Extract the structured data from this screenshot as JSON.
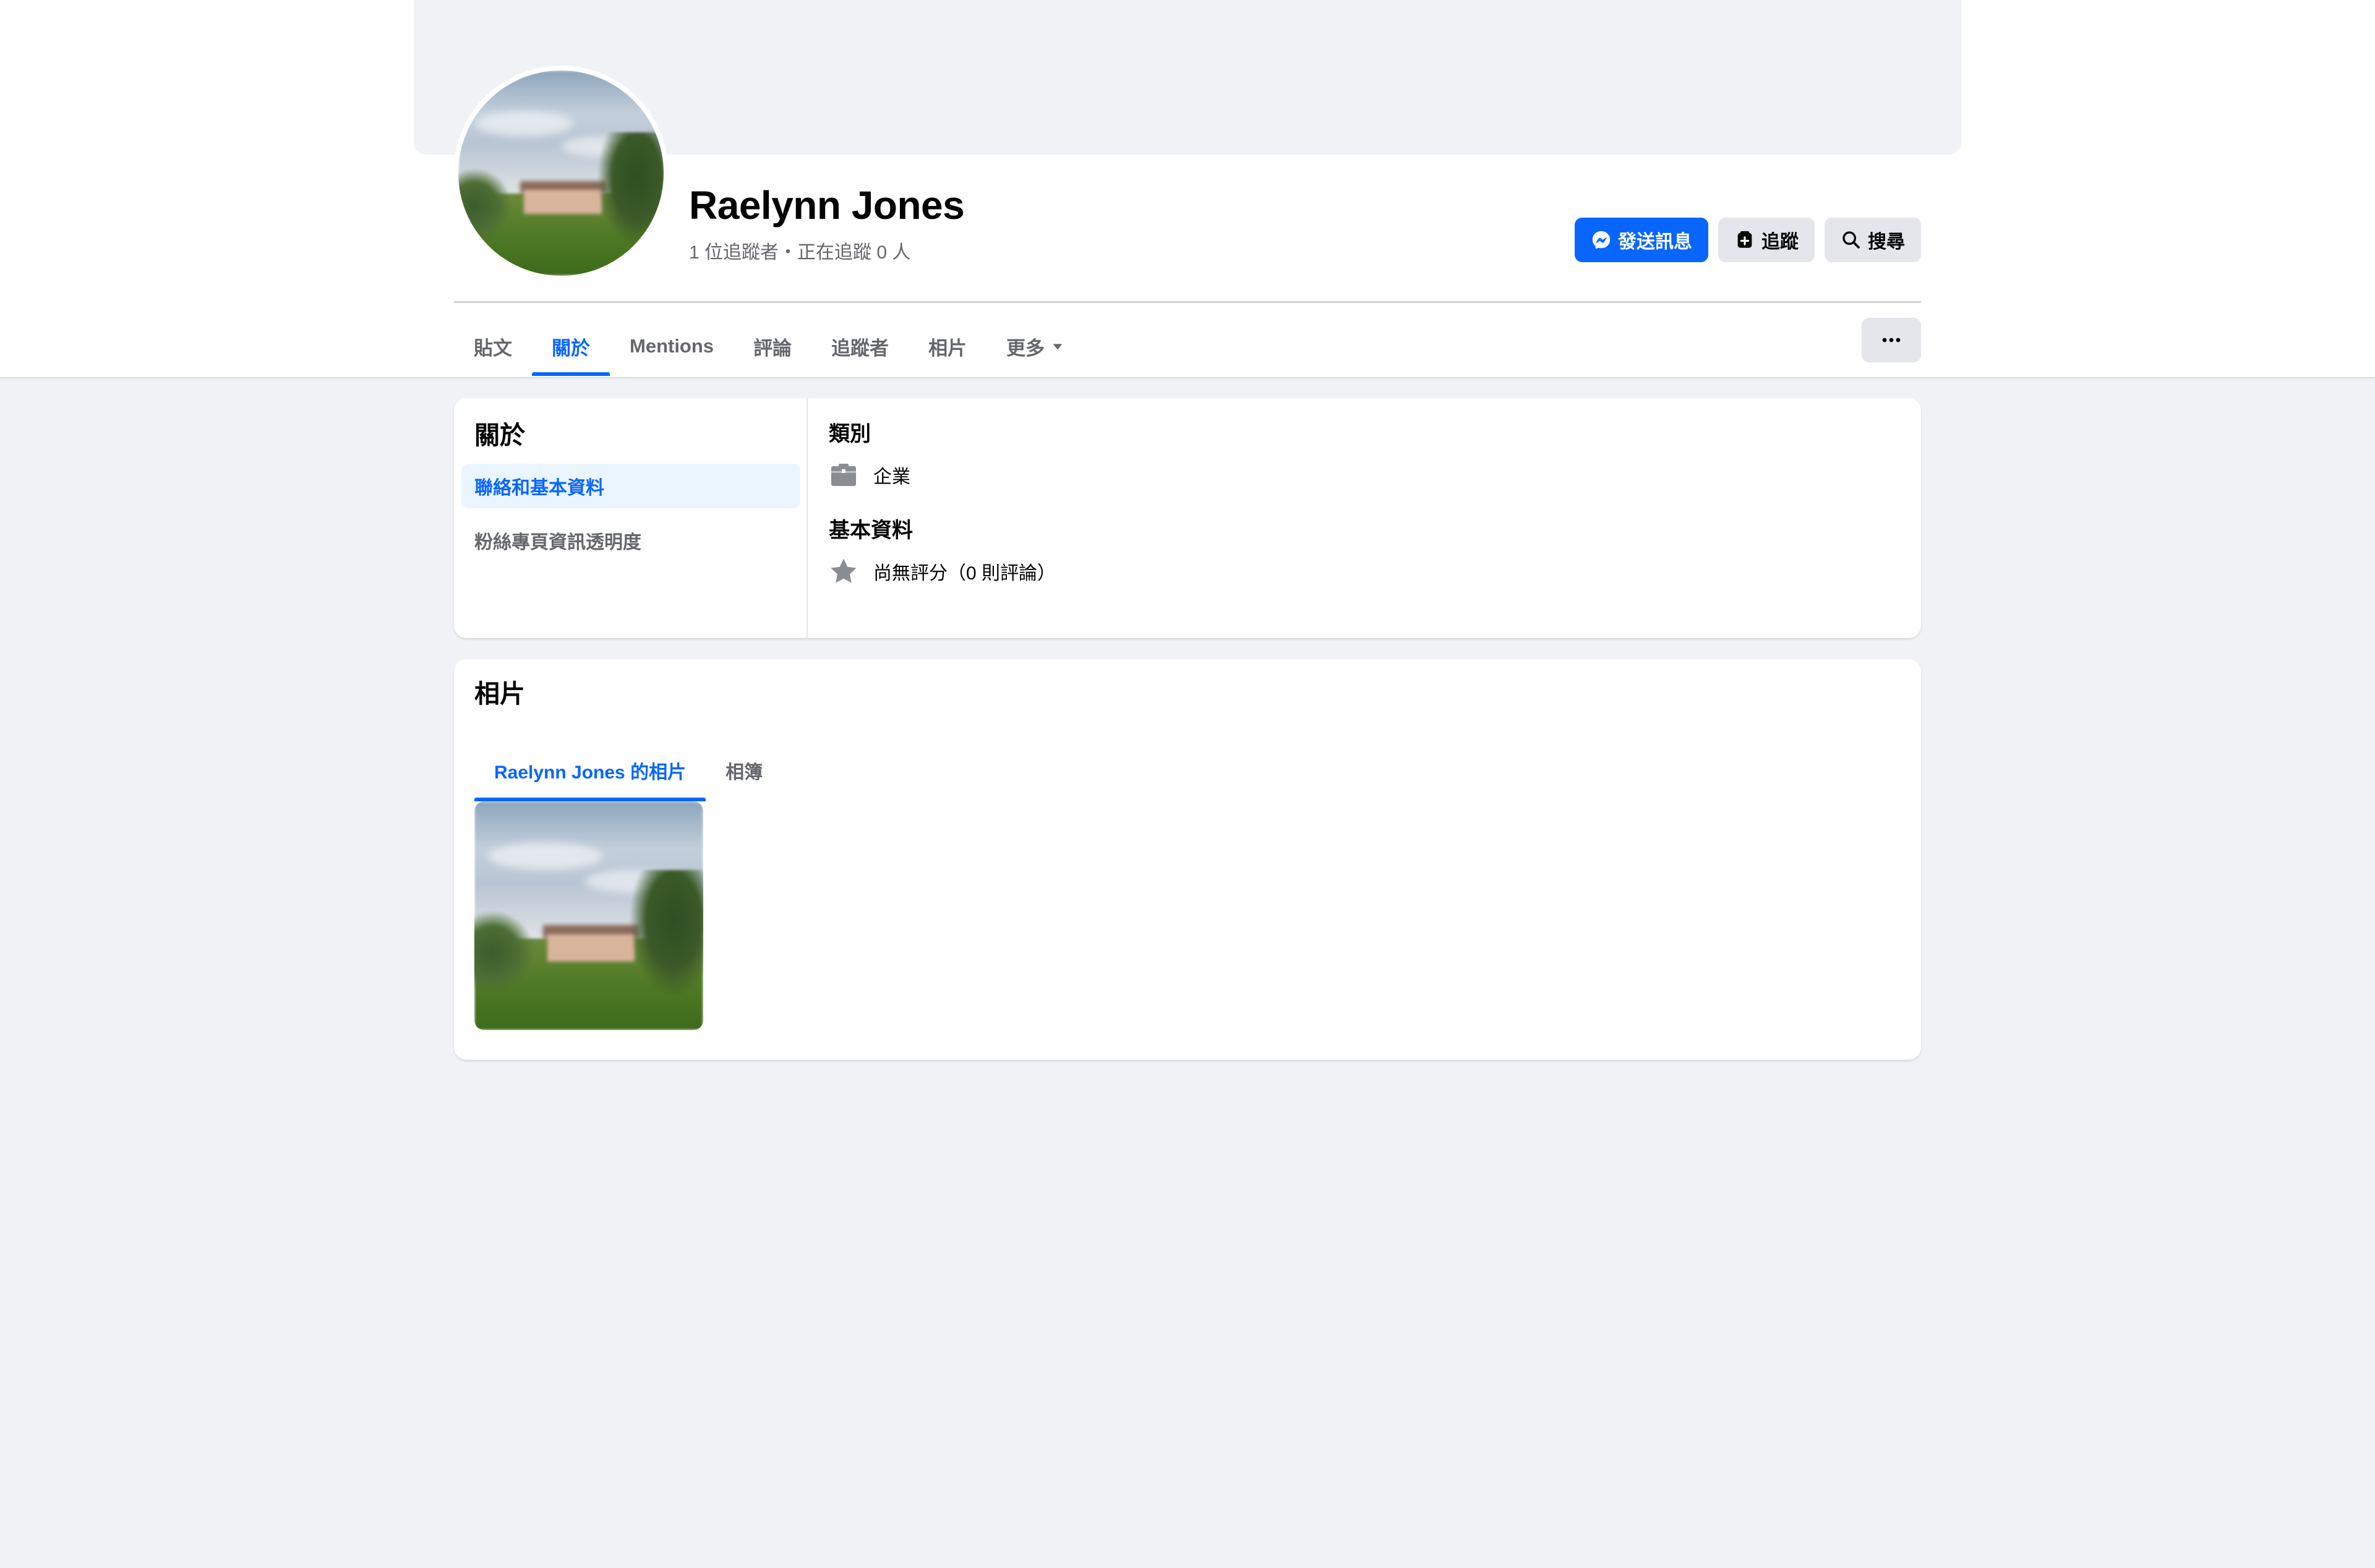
{
  "profile": {
    "name": "Raelynn Jones",
    "stats": "1 位追蹤者・正在追蹤 0 人"
  },
  "actions": {
    "message_label": "發送訊息",
    "follow_label": "追蹤",
    "search_label": "搜尋"
  },
  "tabs": [
    {
      "label": "貼文",
      "active": false
    },
    {
      "label": "關於",
      "active": true
    },
    {
      "label": "Mentions",
      "active": false
    },
    {
      "label": "評論",
      "active": false
    },
    {
      "label": "追蹤者",
      "active": false
    },
    {
      "label": "相片",
      "active": false
    },
    {
      "label": "更多",
      "active": false
    }
  ],
  "about": {
    "title": "關於",
    "nav": [
      {
        "label": "聯絡和基本資料",
        "active": true
      },
      {
        "label": "粉絲專頁資訊透明度",
        "active": false
      }
    ],
    "category_heading": "類別",
    "category_value": "企業",
    "category_icon": "briefcase-icon",
    "basic_heading": "基本資料",
    "rating_value": "尚無評分（0 則評論）",
    "rating_icon": "star-icon"
  },
  "photos": {
    "title": "相片",
    "tabs": [
      {
        "label": "Raelynn Jones 的相片",
        "active": true
      },
      {
        "label": "相簿",
        "active": false
      }
    ]
  },
  "colors": {
    "accent": "#0866ff",
    "page_background": "#f0f2f5",
    "secondary_text": "#65676b"
  }
}
